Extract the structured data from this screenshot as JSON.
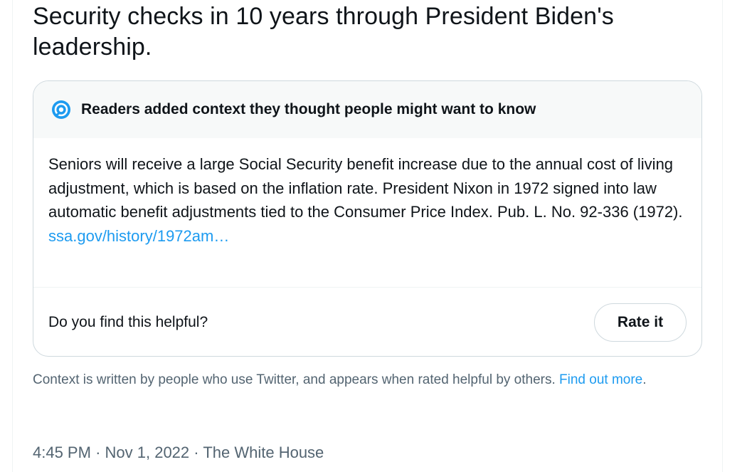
{
  "tweet": {
    "text": "Security checks in 10 years through President Biden's leadership."
  },
  "note": {
    "icon": "community-notes-icon",
    "header": "Readers added context they thought people might want to know",
    "body": "Seniors will receive a large Social Security benefit increase due to the annual cost of living adjustment, which is based on the inflation rate. President Nixon in 1972 signed into law automatic benefit adjustments tied to the Consumer Price Index. Pub. L. No. 92-336 (1972).",
    "link": "ssa.gov/history/1972am…",
    "helpful_question": "Do you find this helpful?",
    "rate_label": "Rate it"
  },
  "context_info": {
    "text": "Context is written by people who use Twitter, and appears when rated helpful by others. ",
    "link": "Find out more",
    "period": "."
  },
  "meta": {
    "time": "4:45 PM",
    "separator": "·",
    "date": "Nov 1, 2022",
    "source": "The White House"
  },
  "colors": {
    "accent": "#1d9bf0",
    "text": "#0f1419",
    "secondary": "#536471"
  }
}
